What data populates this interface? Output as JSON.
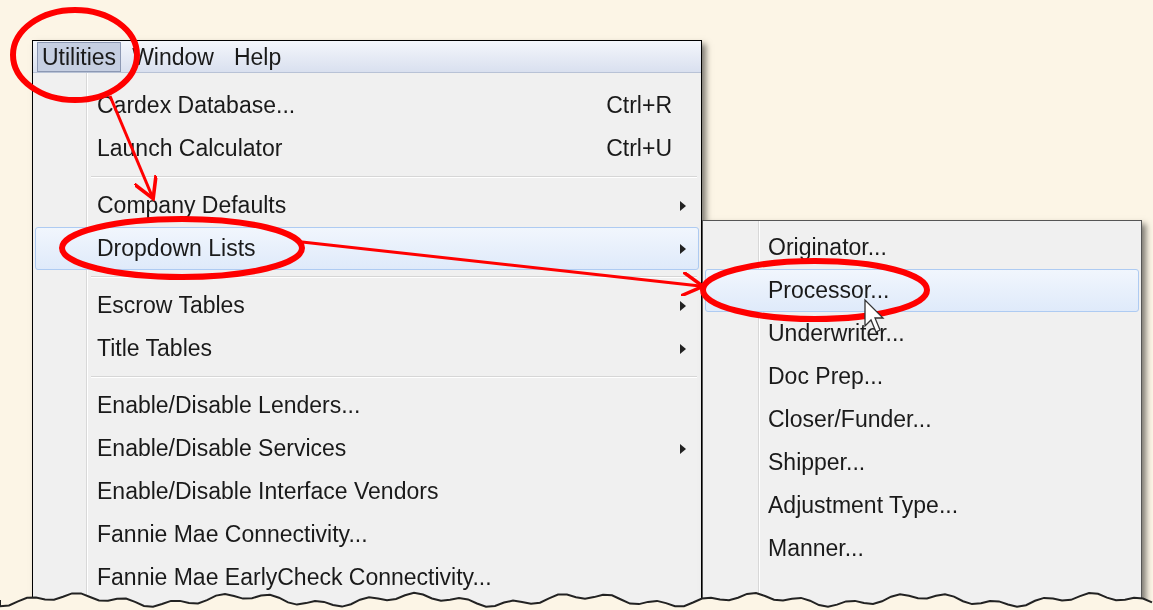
{
  "menu_bar": [
    {
      "label": "Utilities",
      "selected": true
    },
    {
      "label": "Window",
      "selected": false
    },
    {
      "label": "Help",
      "selected": false
    }
  ],
  "menu": {
    "items": [
      {
        "kind": "item",
        "label": "Cardex Database...",
        "shortcut": "Ctrl+R",
        "submenu": false,
        "selected": false
      },
      {
        "kind": "item",
        "label": "Launch Calculator",
        "shortcut": "Ctrl+U",
        "submenu": false,
        "selected": false
      },
      {
        "kind": "separator"
      },
      {
        "kind": "item",
        "label": "Company Defaults",
        "submenu": true,
        "selected": false
      },
      {
        "kind": "item",
        "label": "Dropdown Lists",
        "submenu": true,
        "selected": true
      },
      {
        "kind": "separator"
      },
      {
        "kind": "item",
        "label": "Escrow Tables",
        "submenu": true,
        "selected": false
      },
      {
        "kind": "item",
        "label": "Title Tables",
        "submenu": true,
        "selected": false
      },
      {
        "kind": "separator"
      },
      {
        "kind": "item",
        "label": "Enable/Disable Lenders...",
        "submenu": false,
        "selected": false
      },
      {
        "kind": "item",
        "label": "Enable/Disable Services",
        "submenu": true,
        "selected": false
      },
      {
        "kind": "item",
        "label": "Enable/Disable Interface Vendors",
        "submenu": false,
        "selected": false
      },
      {
        "kind": "item",
        "label": "Fannie Mae Connectivity...",
        "submenu": false,
        "selected": false
      },
      {
        "kind": "item",
        "label": "Fannie Mae EarlyCheck Connectivity...",
        "submenu": false,
        "selected": false
      }
    ]
  },
  "submenu": {
    "items": [
      {
        "label": "Originator...",
        "selected": false
      },
      {
        "label": "Processor...",
        "selected": true
      },
      {
        "label": "Underwriter...",
        "selected": false
      },
      {
        "label": "Doc Prep...",
        "selected": false
      },
      {
        "label": "Closer/Funder...",
        "selected": false
      },
      {
        "label": "Shipper...",
        "selected": false
      },
      {
        "label": "Adjustment Type...",
        "selected": false
      },
      {
        "label": "Manner...",
        "selected": false
      }
    ]
  }
}
